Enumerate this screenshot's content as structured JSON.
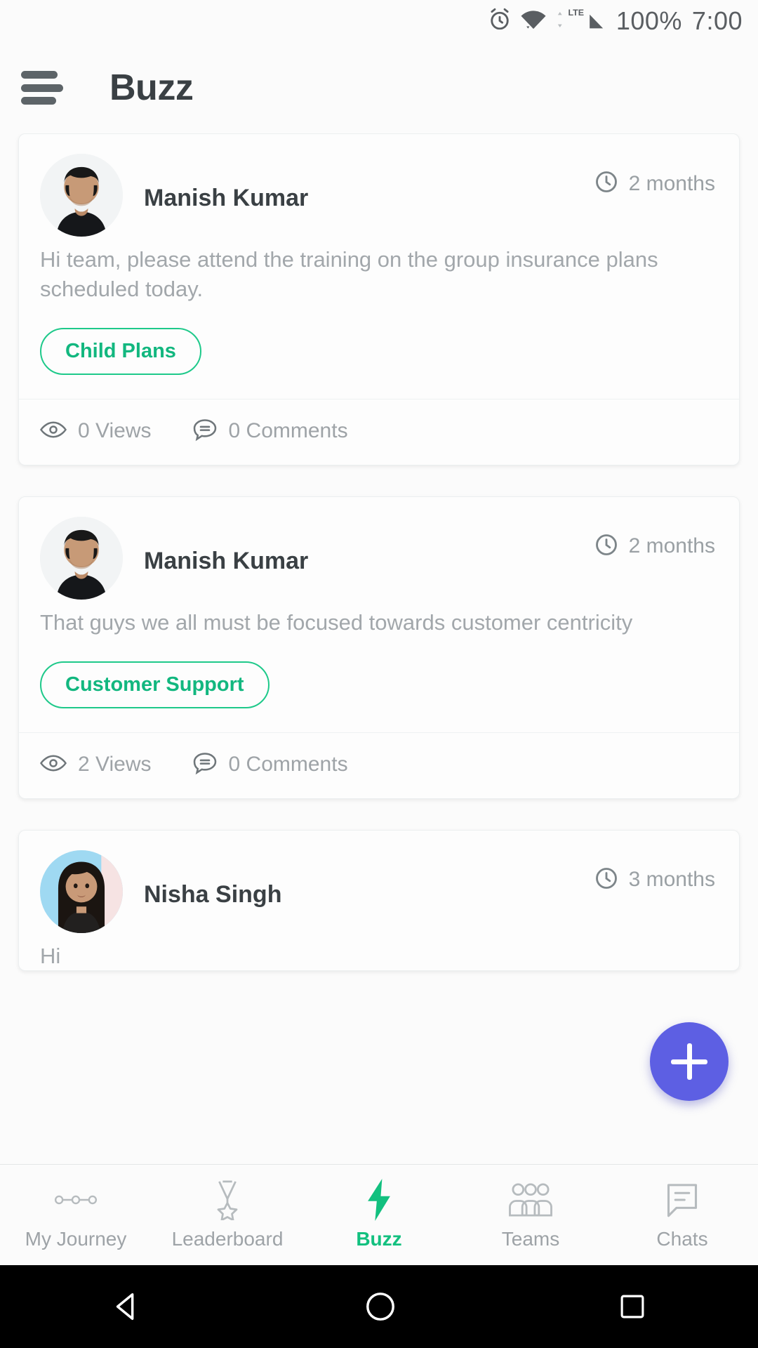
{
  "status_bar": {
    "battery": "100%",
    "time": "7:00",
    "icons": [
      "alarm-icon",
      "wifi-icon",
      "lte-signal-icon"
    ]
  },
  "app_bar": {
    "menu_icon": "hamburger-menu-icon",
    "title": "Buzz"
  },
  "posts": [
    {
      "author": "Manish Kumar",
      "avatar": "male-avatar-photo",
      "time": "2 months",
      "text": "Hi team, please attend the training on the group insurance plans scheduled today.",
      "tag": "Child Plans",
      "views": "0 Views",
      "comments": "0 Comments"
    },
    {
      "author": "Manish Kumar",
      "avatar": "male-avatar-photo",
      "time": "2 months",
      "text": "That guys we all must be focused towards customer centricity",
      "tag": "Customer Support",
      "views": "2 Views",
      "comments": "0 Comments"
    },
    {
      "author": "Nisha Singh",
      "avatar": "female-avatar-photo",
      "time": "3 months",
      "text": "Hi",
      "tag": "",
      "views": "",
      "comments": ""
    }
  ],
  "fab": {
    "label": "add-post",
    "icon": "plus-icon",
    "color": "#5d5fe3"
  },
  "bottom_nav": {
    "items": [
      {
        "label": "My Journey",
        "icon": "journey-path-icon",
        "active": false
      },
      {
        "label": "Leaderboard",
        "icon": "medal-icon",
        "active": false
      },
      {
        "label": "Buzz",
        "icon": "lightning-bolt-icon",
        "active": true
      },
      {
        "label": "Teams",
        "icon": "people-group-icon",
        "active": false
      },
      {
        "label": "Chats",
        "icon": "chat-bubble-icon",
        "active": false
      }
    ],
    "active_color": "#12c07f",
    "inactive_color": "#9ea3a7"
  },
  "system_nav": {
    "back": "back-triangle-icon",
    "home": "home-circle-icon",
    "recents": "recents-square-icon"
  },
  "theme": {
    "accent_green": "#12b77f",
    "chip_border": "#1ec98a",
    "fab_purple": "#5d5fe3",
    "text_dark": "#3a4044",
    "text_muted": "#9ea3a7"
  }
}
